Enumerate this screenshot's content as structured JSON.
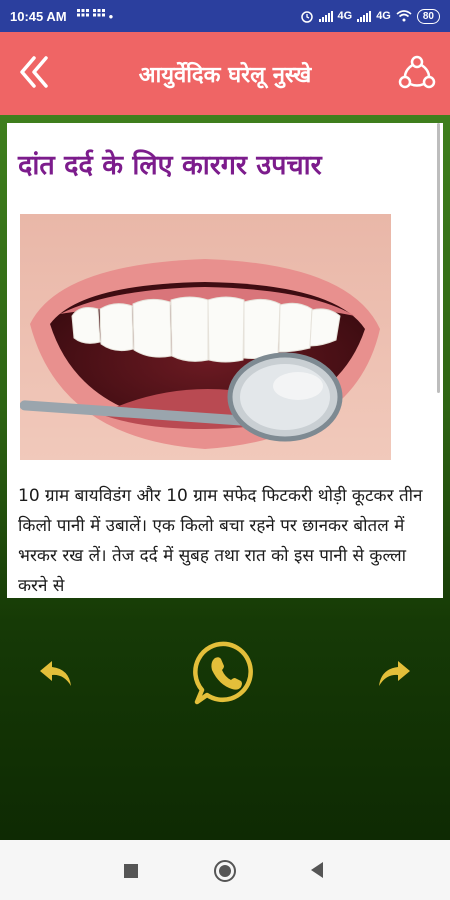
{
  "status_bar": {
    "time": "10:45 AM",
    "network_1": "4G",
    "network_2": "4G",
    "battery": "80"
  },
  "header": {
    "title": "आयुर्वेदिक घरेलू नुस्खे",
    "back_icon": "double-chevron-left-icon",
    "share_icon": "share-icon"
  },
  "article": {
    "title": "दांत दर्द के लिए कारगर उपचार",
    "image": "dental-mirror-teeth-photo",
    "body": "10 ग्राम बायविडंग और 10 ग्राम सफेद फिटकरी थोड़ी कूटकर तीन किलो पानी में उबालें। एक किलो बचा रहने पर छानकर बोतल में भरकर रख लें। तेज दर्द में सुबह तथा रात को इस पानी से कुल्ला करने से"
  },
  "actions": {
    "prev_icon": "reply-arrow-left-icon",
    "share_whatsapp_icon": "whatsapp-icon",
    "next_icon": "forward-arrow-right-icon"
  },
  "colors": {
    "header": "#ef6565",
    "status_bar": "#2b3f9e",
    "title": "#7c1c8c",
    "icon_gold": "#e3bf3a"
  }
}
